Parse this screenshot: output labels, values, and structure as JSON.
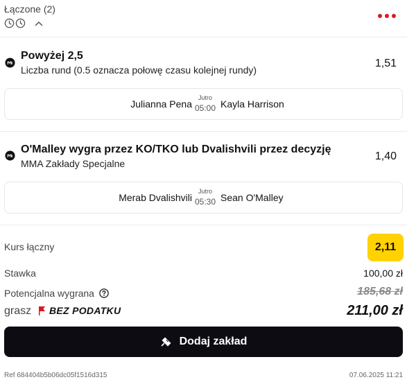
{
  "header": {
    "title": "Łączone (2)"
  },
  "selections": [
    {
      "title": "Powyżej 2,5",
      "subtitle": "Liczba rund (0.5 oznacza połowę czasu kolejnej rundy)",
      "odds": "1,51",
      "match": {
        "home": "Julianna Pena",
        "away": "Kayla Harrison",
        "day": "Jutro",
        "time": "05:00"
      }
    },
    {
      "title": "O'Malley wygra przez KO/TKO lub Dvalishvili przez decyzję",
      "subtitle": "MMA Zakłady Specjalne",
      "odds": "1,40",
      "match": {
        "home": "Merab Dvalishvili",
        "away": "Sean O'Malley",
        "day": "Jutro",
        "time": "05:30"
      }
    }
  ],
  "summary": {
    "total_odds_label": "Kurs łączny",
    "total_odds": "2,11",
    "stake_label": "Stawka",
    "stake": "100,00 zł",
    "potential_label": "Potencjalna wygrana",
    "potential_old": "185,68 zł",
    "grasz_label": "grasz",
    "tax_free": "BEZ PODATKU",
    "potential_final": "211,00 zł"
  },
  "add_bet_label": "Dodaj zakład",
  "footer": {
    "ref": "Ref 684404b5b06dc05f1516d315",
    "date": "07.06.2025 11:21"
  },
  "colors": {
    "accent_red": "#d71a22",
    "odds_badge": "#ffd200",
    "button_dark": "#0c0c12"
  },
  "icons": [
    "clock-icon",
    "chevron-up-icon",
    "more-icon",
    "mma-sport-icon",
    "help-icon",
    "flag-icon",
    "ticket-icon"
  ]
}
